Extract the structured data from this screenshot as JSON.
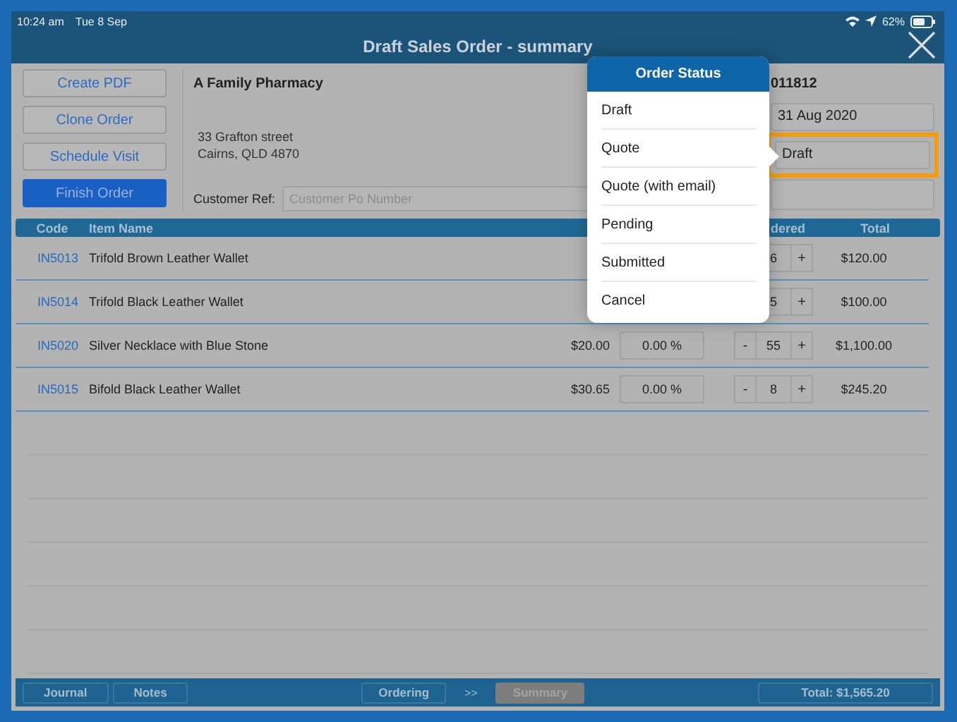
{
  "status_bar": {
    "time": "10:24 am",
    "date": "Tue 8 Sep",
    "battery": "62%"
  },
  "window": {
    "title": "Draft Sales Order - summary"
  },
  "actions": [
    {
      "label": "Create PDF",
      "primary": false
    },
    {
      "label": "Clone Order",
      "primary": false
    },
    {
      "label": "Schedule Visit",
      "primary": false
    },
    {
      "label": "Finish Order",
      "primary": true
    }
  ],
  "customer": {
    "name": "A Family Pharmacy",
    "address": [
      "33 Grafton street",
      "Cairns, QLD 4870"
    ],
    "ref_label": "Customer Ref:",
    "ref_placeholder": "Customer Po Number"
  },
  "order": {
    "number": "011812",
    "date": "31 Aug 2020",
    "status": "Draft",
    "status_highlighted": true
  },
  "table": {
    "columns": [
      "Code",
      "Item Name",
      "dered",
      "Total"
    ],
    "rows": [
      {
        "code": "IN5013",
        "name": "Trifold Brown Leather Wallet",
        "qty": "6",
        "plus": "+",
        "total": "$120.00"
      },
      {
        "code": "IN5014",
        "name": "Trifold Black Leather Wallet",
        "qty": "5",
        "plus": "+",
        "total": "$100.00"
      },
      {
        "code": "IN5020",
        "name": "Silver Necklace with Blue Stone",
        "price": "$20.00",
        "discount": "0.00 %",
        "minus": "-",
        "qty": "55",
        "plus": "+",
        "total": "$1,100.00"
      },
      {
        "code": "IN5015",
        "name": "Bifold Black Leather Wallet",
        "price": "$30.65",
        "discount": "0.00 %",
        "minus": "-",
        "qty": "8",
        "plus": "+",
        "total": "$245.20"
      }
    ]
  },
  "footer": {
    "left": [
      {
        "label": "Journal"
      },
      {
        "label": "Notes"
      }
    ],
    "steps": [
      {
        "label": "Ordering",
        "selected": false
      },
      {
        "label": "Summary",
        "selected": true
      }
    ],
    "separator": ">>",
    "total": "Total: $1,565.20"
  },
  "popover": {
    "title": "Order Status",
    "items": [
      "Draft",
      "Quote",
      "Quote (with email)",
      "Pending",
      "Submitted",
      "Cancel"
    ]
  }
}
